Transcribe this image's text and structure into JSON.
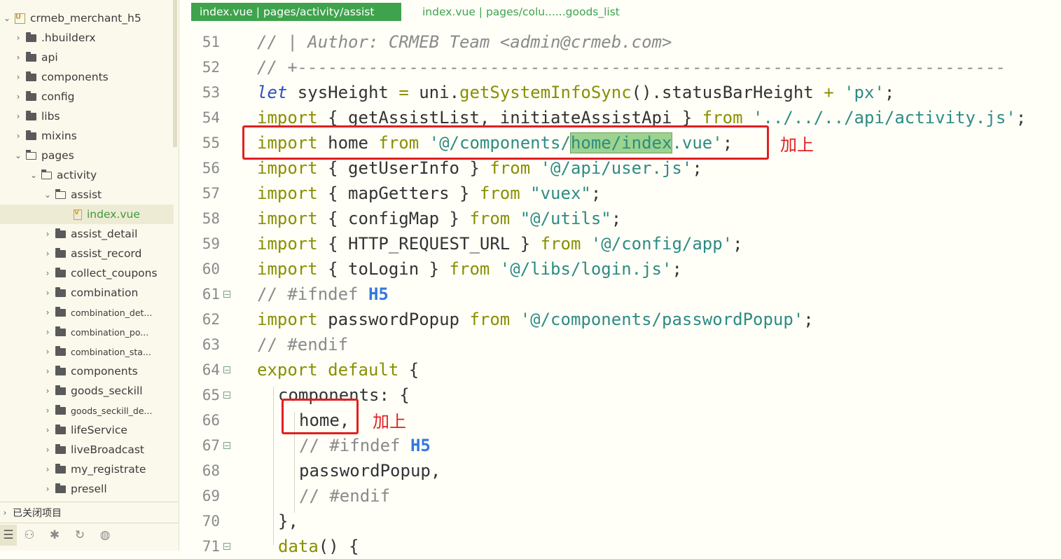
{
  "sidebar": {
    "project": "crmeb_merchant_h5",
    "items": [
      {
        "label": "crmeb_merchant_h5",
        "type": "project",
        "expanded": true,
        "depth": 0
      },
      {
        "label": ".hbuilderx",
        "type": "folder",
        "expanded": false,
        "depth": 1
      },
      {
        "label": "api",
        "type": "folder",
        "expanded": false,
        "depth": 1
      },
      {
        "label": "components",
        "type": "folder",
        "expanded": false,
        "depth": 1
      },
      {
        "label": "config",
        "type": "folder",
        "expanded": false,
        "depth": 1
      },
      {
        "label": "libs",
        "type": "folder",
        "expanded": false,
        "depth": 1
      },
      {
        "label": "mixins",
        "type": "folder",
        "expanded": false,
        "depth": 1
      },
      {
        "label": "pages",
        "type": "folder",
        "expanded": true,
        "depth": 1
      },
      {
        "label": "activity",
        "type": "folder",
        "expanded": true,
        "depth": 2
      },
      {
        "label": "assist",
        "type": "folder",
        "expanded": true,
        "depth": 3
      },
      {
        "label": "index.vue",
        "type": "file",
        "selected": true,
        "depth": 4
      },
      {
        "label": "assist_detail",
        "type": "folder",
        "expanded": false,
        "depth": 3
      },
      {
        "label": "assist_record",
        "type": "folder",
        "expanded": false,
        "depth": 3
      },
      {
        "label": "collect_coupons",
        "type": "folder",
        "expanded": false,
        "depth": 3
      },
      {
        "label": "combination",
        "type": "folder",
        "expanded": false,
        "depth": 3
      },
      {
        "label": "combination_det...",
        "type": "folder",
        "expanded": false,
        "depth": 3,
        "small": true
      },
      {
        "label": "combination_po...",
        "type": "folder",
        "expanded": false,
        "depth": 3,
        "small": true
      },
      {
        "label": "combination_sta...",
        "type": "folder",
        "expanded": false,
        "depth": 3,
        "small": true
      },
      {
        "label": "components",
        "type": "folder",
        "expanded": false,
        "depth": 3
      },
      {
        "label": "goods_seckill",
        "type": "folder",
        "expanded": false,
        "depth": 3
      },
      {
        "label": "goods_seckill_de...",
        "type": "folder",
        "expanded": false,
        "depth": 3,
        "small": true
      },
      {
        "label": "lifeService",
        "type": "folder",
        "expanded": false,
        "depth": 3
      },
      {
        "label": "liveBroadcast",
        "type": "folder",
        "expanded": false,
        "depth": 3
      },
      {
        "label": "my_registrate",
        "type": "folder",
        "expanded": false,
        "depth": 3
      },
      {
        "label": "presell",
        "type": "folder",
        "expanded": false,
        "depth": 3
      }
    ],
    "closed_projects": "已关闭项目",
    "toolbar_icons": [
      "explorer-icon",
      "binoculars-icon",
      "bug-icon",
      "refresh-search-icon",
      "globe-icon"
    ]
  },
  "tabs": [
    {
      "label": "index.vue | pages/activity/assist",
      "active": true
    },
    {
      "label": "index.vue | pages/colu......goods_list",
      "active": false
    }
  ],
  "editor": {
    "lines": [
      {
        "n": "51",
        "fold": false,
        "indent": 0,
        "tokens": [
          [
            "cm",
            "// | Author: CRMEB Team <admin@crmeb.com>"
          ]
        ]
      },
      {
        "n": "52",
        "fold": false,
        "indent": 0,
        "tokens": [
          [
            "cm",
            "// +----------------------------------------------------------------------"
          ]
        ]
      },
      {
        "n": "53",
        "fold": false,
        "indent": 0,
        "tokens": [
          [
            "kw-it",
            "let"
          ],
          [
            "plain",
            " sysHeight "
          ],
          [
            "op",
            "="
          ],
          [
            "plain",
            " uni."
          ],
          [
            "fn",
            "getSystemInfoSync"
          ],
          [
            "plain",
            "().statusBarHeight "
          ],
          [
            "op",
            "+"
          ],
          [
            "plain",
            " "
          ],
          [
            "str",
            "'px'"
          ],
          [
            "plain",
            ";"
          ]
        ]
      },
      {
        "n": "54",
        "fold": false,
        "indent": 0,
        "tokens": [
          [
            "kw",
            "import"
          ],
          [
            "plain",
            " { getAssistList, initiateAssistApi } "
          ],
          [
            "kw",
            "from"
          ],
          [
            "plain",
            " "
          ],
          [
            "str",
            "'../../../api/activity.js'"
          ],
          [
            "plain",
            ";"
          ]
        ]
      },
      {
        "n": "55",
        "fold": false,
        "indent": 0,
        "tokens": [
          [
            "kw",
            "import"
          ],
          [
            "plain",
            " home "
          ],
          [
            "kw",
            "from"
          ],
          [
            "plain",
            " "
          ],
          [
            "str",
            "'@/components/"
          ],
          [
            "str-hl",
            "home/index"
          ],
          [
            "str",
            ".vue'"
          ],
          [
            "plain",
            ";"
          ]
        ]
      },
      {
        "n": "56",
        "fold": false,
        "indent": 0,
        "tokens": [
          [
            "kw",
            "import"
          ],
          [
            "plain",
            " { getUserInfo } "
          ],
          [
            "kw",
            "from"
          ],
          [
            "plain",
            " "
          ],
          [
            "str",
            "'@/api/user.js'"
          ],
          [
            "plain",
            ";"
          ]
        ]
      },
      {
        "n": "57",
        "fold": false,
        "indent": 0,
        "tokens": [
          [
            "kw",
            "import"
          ],
          [
            "plain",
            " { mapGetters } "
          ],
          [
            "kw",
            "from"
          ],
          [
            "plain",
            " "
          ],
          [
            "str",
            "\"vuex\""
          ],
          [
            "plain",
            ";"
          ]
        ]
      },
      {
        "n": "58",
        "fold": false,
        "indent": 0,
        "tokens": [
          [
            "kw",
            "import"
          ],
          [
            "plain",
            " { configMap } "
          ],
          [
            "kw",
            "from"
          ],
          [
            "plain",
            " "
          ],
          [
            "str",
            "\"@/utils\""
          ],
          [
            "plain",
            ";"
          ]
        ]
      },
      {
        "n": "59",
        "fold": false,
        "indent": 0,
        "tokens": [
          [
            "kw",
            "import"
          ],
          [
            "plain",
            " { HTTP_REQUEST_URL } "
          ],
          [
            "kw",
            "from"
          ],
          [
            "plain",
            " "
          ],
          [
            "str",
            "'@/config/app'"
          ],
          [
            "plain",
            ";"
          ]
        ]
      },
      {
        "n": "60",
        "fold": false,
        "indent": 0,
        "tokens": [
          [
            "kw",
            "import"
          ],
          [
            "plain",
            " { toLogin } "
          ],
          [
            "kw",
            "from"
          ],
          [
            "plain",
            " "
          ],
          [
            "str",
            "'@/libs/login.js'"
          ],
          [
            "plain",
            ";"
          ]
        ]
      },
      {
        "n": "61",
        "fold": true,
        "indent": 0,
        "tokens": [
          [
            "pp",
            "// #ifndef "
          ],
          [
            "pp-arg",
            "H5"
          ]
        ]
      },
      {
        "n": "62",
        "fold": false,
        "indent": 0,
        "tokens": [
          [
            "kw",
            "import"
          ],
          [
            "plain",
            " passwordPopup "
          ],
          [
            "kw",
            "from"
          ],
          [
            "plain",
            " "
          ],
          [
            "str",
            "'@/components/passwordPopup'"
          ],
          [
            "plain",
            ";"
          ]
        ]
      },
      {
        "n": "63",
        "fold": false,
        "indent": 0,
        "tokens": [
          [
            "pp",
            "// #endif"
          ]
        ]
      },
      {
        "n": "64",
        "fold": true,
        "indent": 0,
        "tokens": [
          [
            "kw",
            "export"
          ],
          [
            "plain",
            " "
          ],
          [
            "kw",
            "default"
          ],
          [
            "plain",
            " {"
          ]
        ]
      },
      {
        "n": "65",
        "fold": true,
        "indent": 1,
        "tokens": [
          [
            "plain",
            "components: {"
          ]
        ]
      },
      {
        "n": "66",
        "fold": false,
        "indent": 2,
        "tokens": [
          [
            "plain",
            "home,"
          ]
        ]
      },
      {
        "n": "67",
        "fold": true,
        "indent": 2,
        "tokens": [
          [
            "pp",
            "// #ifndef "
          ],
          [
            "pp-arg",
            "H5"
          ]
        ]
      },
      {
        "n": "68",
        "fold": false,
        "indent": 2,
        "tokens": [
          [
            "plain",
            "passwordPopup,"
          ]
        ]
      },
      {
        "n": "69",
        "fold": false,
        "indent": 2,
        "tokens": [
          [
            "pp",
            "// #endif"
          ]
        ]
      },
      {
        "n": "70",
        "fold": false,
        "indent": 1,
        "tokens": [
          [
            "plain",
            "},"
          ]
        ]
      },
      {
        "n": "71",
        "fold": true,
        "indent": 1,
        "tokens": [
          [
            "fn",
            "data"
          ],
          [
            "plain",
            "() {"
          ]
        ]
      }
    ]
  },
  "annotations": [
    {
      "note": "加上",
      "line": "55"
    },
    {
      "note": "加上",
      "line": "66"
    }
  ],
  "colors": {
    "accent": "#3fa34d",
    "annotation": "#e02020",
    "highlight": "#9cd38e"
  }
}
